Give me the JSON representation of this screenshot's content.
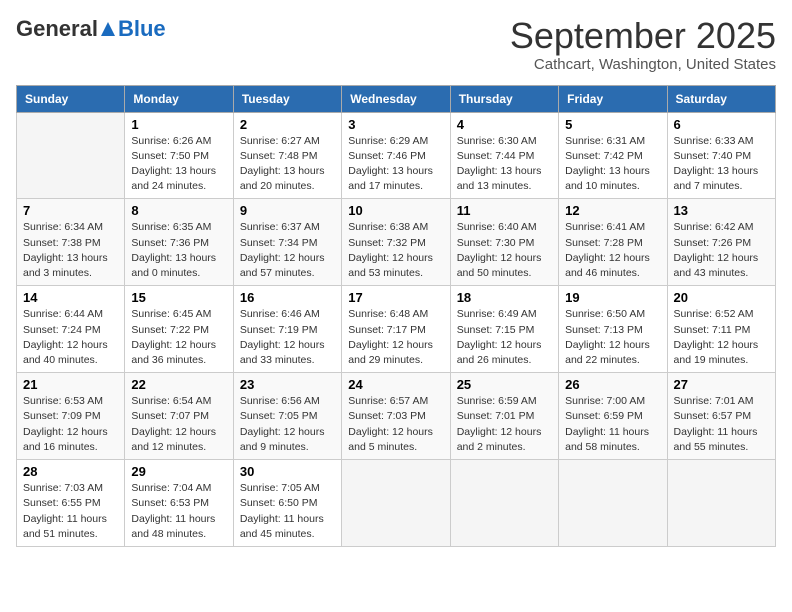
{
  "logo": {
    "general": "General",
    "blue": "Blue"
  },
  "title": "September 2025",
  "location": "Cathcart, Washington, United States",
  "weekdays": [
    "Sunday",
    "Monday",
    "Tuesday",
    "Wednesday",
    "Thursday",
    "Friday",
    "Saturday"
  ],
  "weeks": [
    [
      {
        "day": "",
        "info": ""
      },
      {
        "day": "1",
        "info": "Sunrise: 6:26 AM\nSunset: 7:50 PM\nDaylight: 13 hours\nand 24 minutes."
      },
      {
        "day": "2",
        "info": "Sunrise: 6:27 AM\nSunset: 7:48 PM\nDaylight: 13 hours\nand 20 minutes."
      },
      {
        "day": "3",
        "info": "Sunrise: 6:29 AM\nSunset: 7:46 PM\nDaylight: 13 hours\nand 17 minutes."
      },
      {
        "day": "4",
        "info": "Sunrise: 6:30 AM\nSunset: 7:44 PM\nDaylight: 13 hours\nand 13 minutes."
      },
      {
        "day": "5",
        "info": "Sunrise: 6:31 AM\nSunset: 7:42 PM\nDaylight: 13 hours\nand 10 minutes."
      },
      {
        "day": "6",
        "info": "Sunrise: 6:33 AM\nSunset: 7:40 PM\nDaylight: 13 hours\nand 7 minutes."
      }
    ],
    [
      {
        "day": "7",
        "info": "Sunrise: 6:34 AM\nSunset: 7:38 PM\nDaylight: 13 hours\nand 3 minutes."
      },
      {
        "day": "8",
        "info": "Sunrise: 6:35 AM\nSunset: 7:36 PM\nDaylight: 13 hours\nand 0 minutes."
      },
      {
        "day": "9",
        "info": "Sunrise: 6:37 AM\nSunset: 7:34 PM\nDaylight: 12 hours\nand 57 minutes."
      },
      {
        "day": "10",
        "info": "Sunrise: 6:38 AM\nSunset: 7:32 PM\nDaylight: 12 hours\nand 53 minutes."
      },
      {
        "day": "11",
        "info": "Sunrise: 6:40 AM\nSunset: 7:30 PM\nDaylight: 12 hours\nand 50 minutes."
      },
      {
        "day": "12",
        "info": "Sunrise: 6:41 AM\nSunset: 7:28 PM\nDaylight: 12 hours\nand 46 minutes."
      },
      {
        "day": "13",
        "info": "Sunrise: 6:42 AM\nSunset: 7:26 PM\nDaylight: 12 hours\nand 43 minutes."
      }
    ],
    [
      {
        "day": "14",
        "info": "Sunrise: 6:44 AM\nSunset: 7:24 PM\nDaylight: 12 hours\nand 40 minutes."
      },
      {
        "day": "15",
        "info": "Sunrise: 6:45 AM\nSunset: 7:22 PM\nDaylight: 12 hours\nand 36 minutes."
      },
      {
        "day": "16",
        "info": "Sunrise: 6:46 AM\nSunset: 7:19 PM\nDaylight: 12 hours\nand 33 minutes."
      },
      {
        "day": "17",
        "info": "Sunrise: 6:48 AM\nSunset: 7:17 PM\nDaylight: 12 hours\nand 29 minutes."
      },
      {
        "day": "18",
        "info": "Sunrise: 6:49 AM\nSunset: 7:15 PM\nDaylight: 12 hours\nand 26 minutes."
      },
      {
        "day": "19",
        "info": "Sunrise: 6:50 AM\nSunset: 7:13 PM\nDaylight: 12 hours\nand 22 minutes."
      },
      {
        "day": "20",
        "info": "Sunrise: 6:52 AM\nSunset: 7:11 PM\nDaylight: 12 hours\nand 19 minutes."
      }
    ],
    [
      {
        "day": "21",
        "info": "Sunrise: 6:53 AM\nSunset: 7:09 PM\nDaylight: 12 hours\nand 16 minutes."
      },
      {
        "day": "22",
        "info": "Sunrise: 6:54 AM\nSunset: 7:07 PM\nDaylight: 12 hours\nand 12 minutes."
      },
      {
        "day": "23",
        "info": "Sunrise: 6:56 AM\nSunset: 7:05 PM\nDaylight: 12 hours\nand 9 minutes."
      },
      {
        "day": "24",
        "info": "Sunrise: 6:57 AM\nSunset: 7:03 PM\nDaylight: 12 hours\nand 5 minutes."
      },
      {
        "day": "25",
        "info": "Sunrise: 6:59 AM\nSunset: 7:01 PM\nDaylight: 12 hours\nand 2 minutes."
      },
      {
        "day": "26",
        "info": "Sunrise: 7:00 AM\nSunset: 6:59 PM\nDaylight: 11 hours\nand 58 minutes."
      },
      {
        "day": "27",
        "info": "Sunrise: 7:01 AM\nSunset: 6:57 PM\nDaylight: 11 hours\nand 55 minutes."
      }
    ],
    [
      {
        "day": "28",
        "info": "Sunrise: 7:03 AM\nSunset: 6:55 PM\nDaylight: 11 hours\nand 51 minutes."
      },
      {
        "day": "29",
        "info": "Sunrise: 7:04 AM\nSunset: 6:53 PM\nDaylight: 11 hours\nand 48 minutes."
      },
      {
        "day": "30",
        "info": "Sunrise: 7:05 AM\nSunset: 6:50 PM\nDaylight: 11 hours\nand 45 minutes."
      },
      {
        "day": "",
        "info": ""
      },
      {
        "day": "",
        "info": ""
      },
      {
        "day": "",
        "info": ""
      },
      {
        "day": "",
        "info": ""
      }
    ]
  ]
}
